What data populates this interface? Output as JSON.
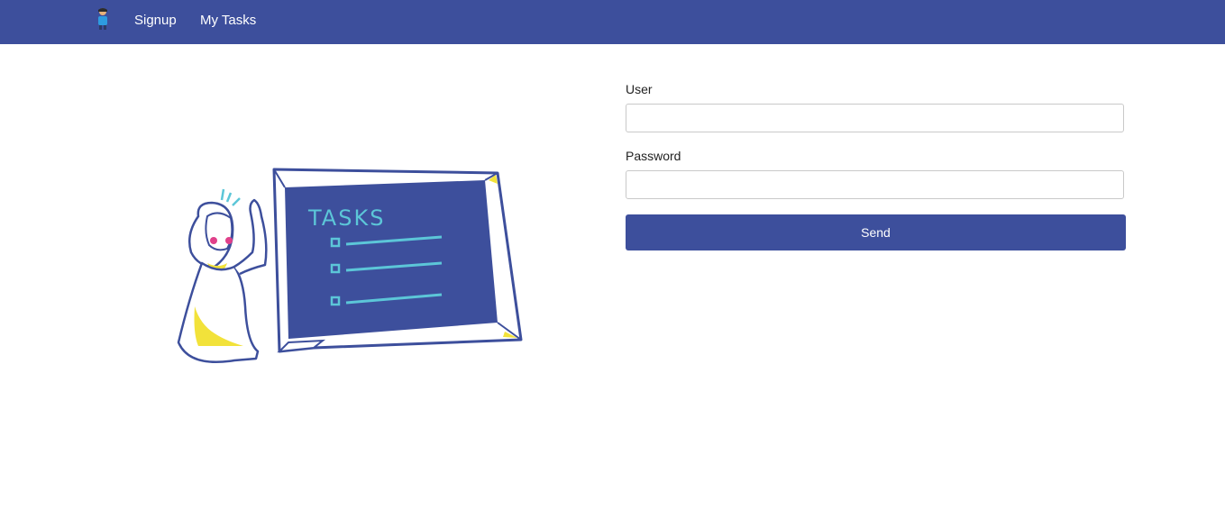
{
  "nav": {
    "brand_icon": "person-icon",
    "links": [
      {
        "label": "Signup"
      },
      {
        "label": "My Tasks"
      }
    ]
  },
  "illustration": {
    "board_text": "TASKS",
    "icon": "tasks-board-illustration"
  },
  "form": {
    "user_label": "User",
    "user_value": "",
    "password_label": "Password",
    "password_value": "",
    "send_label": "Send"
  },
  "colors": {
    "primary": "#3d4f9c",
    "accent_yellow": "#f2e23a",
    "accent_cyan": "#5cc6d8",
    "accent_pink": "#e0408a"
  }
}
